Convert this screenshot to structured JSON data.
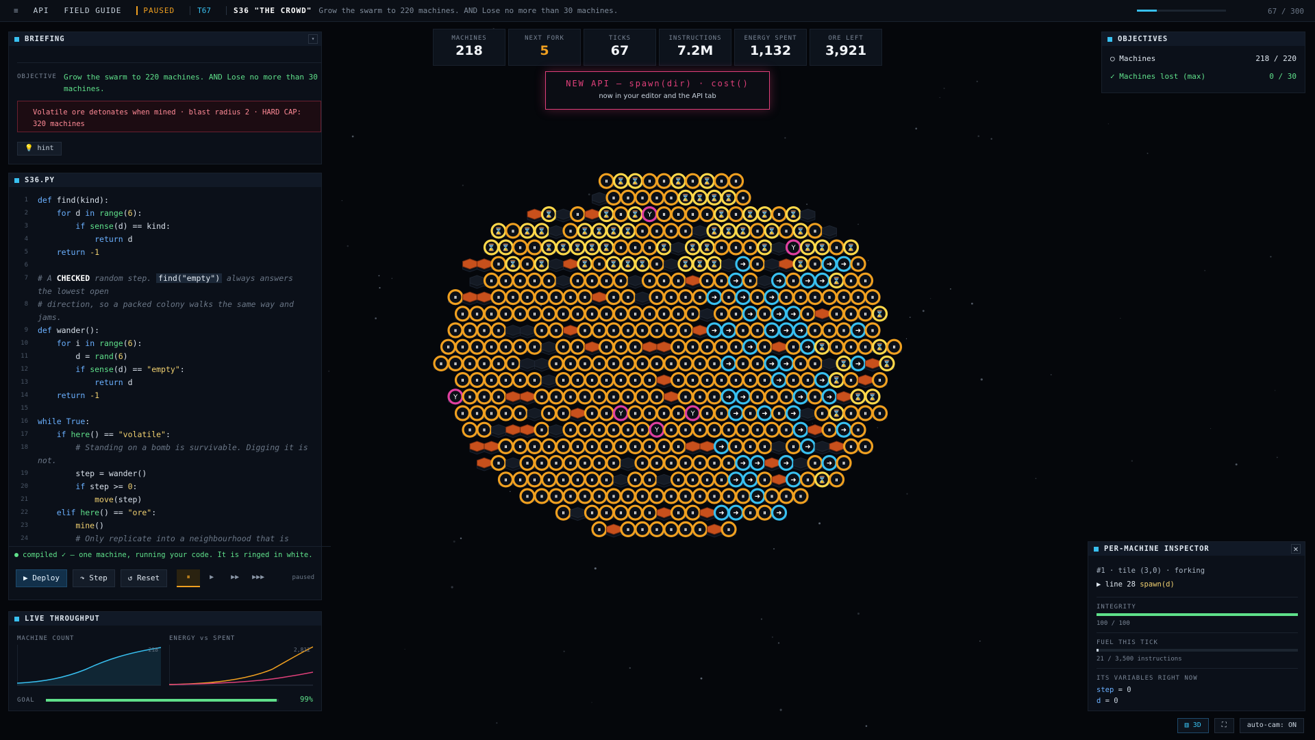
{
  "topbar": {
    "menu_icon": "menu-icon",
    "nav_api": "API",
    "nav_guide": "FIELD GUIDE",
    "state": "PAUSED",
    "tick": "T67",
    "level": "S36 \"THE CROWD\"",
    "objective": "Grow the swarm to 220 machines. AND Lose no more than 30 machines.",
    "progress_text": "67 / 300",
    "progress_fraction": 0.22
  },
  "briefing": {
    "title": "BRIEFING",
    "objective_label": "OBJECTIVE",
    "objective_text": "Grow the swarm to 220 machines. AND Lose no more than 30 machines.",
    "warning": "Volatile ore detonates when mined · blast radius 2 · HARD CAP: 320 machines",
    "hint_icon": "lightbulb-icon",
    "hint_label": "hint"
  },
  "editor": {
    "title": "S36.PY",
    "status": "compiled ✓ — one machine, running your code. It is ringed in white.",
    "deploy": "▶ Deploy",
    "step": "↷ Step",
    "reset": "↺ Reset",
    "speeds": [
      "⏸",
      "▶",
      "▶▶",
      "▶▶▶"
    ],
    "run_state": "paused"
  },
  "throughput": {
    "title": "LIVE THROUGHPUT",
    "machine_count_label": "MACHINE COUNT",
    "machine_count_max": "218",
    "energy_label": "ENERGY vs SPENT",
    "energy_max": "2,812",
    "goal_label": "GOAL",
    "goal_percent": "99%",
    "goal_fraction": 0.99
  },
  "stats": [
    {
      "label": "MACHINES",
      "value": "218"
    },
    {
      "label": "NEXT FORK",
      "value": "5"
    },
    {
      "label": "TICKS",
      "value": "67"
    },
    {
      "label": "INSTRUCTIONS",
      "value": "7.2M"
    },
    {
      "label": "ENERGY SPENT",
      "value": "1,132"
    },
    {
      "label": "ORE LEFT",
      "value": "3,921"
    }
  ],
  "api_banner": {
    "title": "NEW API — spawn(dir) · cost()",
    "subtitle": "now in your editor and the API tab"
  },
  "objectives": {
    "title": "OBJECTIVES",
    "items": [
      {
        "mark": "○",
        "label": "Machines",
        "value": "218 / 220"
      },
      {
        "mark": "✓",
        "label": "Machines lost (max)",
        "value": "0 / 30"
      }
    ]
  },
  "inspector": {
    "title": "PER-MACHINE INSPECTOR",
    "close_icon": "close-icon",
    "machine": "#1 · tile (3,0) · forking",
    "line_label": "▶ line 28",
    "line_code": "spawn(d)",
    "integrity_label": "INTEGRITY",
    "integrity_text": "100 / 100",
    "integrity_fraction": 1.0,
    "fuel_label": "FUEL THIS TICK",
    "fuel_text": "21 / 3,500 instructions",
    "fuel_fraction": 0.006,
    "vars_label": "ITS VARIABLES RIGHT NOW",
    "vars": [
      {
        "name": "step",
        "value": "= 0"
      },
      {
        "name": "d",
        "value": "= 0"
      }
    ]
  },
  "view": {
    "mode": "▥ 3D",
    "fullscreen_icon": "fullscreen-icon",
    "autocam": "auto-cam: ON"
  },
  "colors": {
    "accent": "#38c0f0",
    "miner": "#f0a020",
    "forking": "#ffd84a",
    "spawner": "#e040a0",
    "ore": "#c8501c",
    "ok": "#5fe08a",
    "danger": "#e0407a"
  }
}
